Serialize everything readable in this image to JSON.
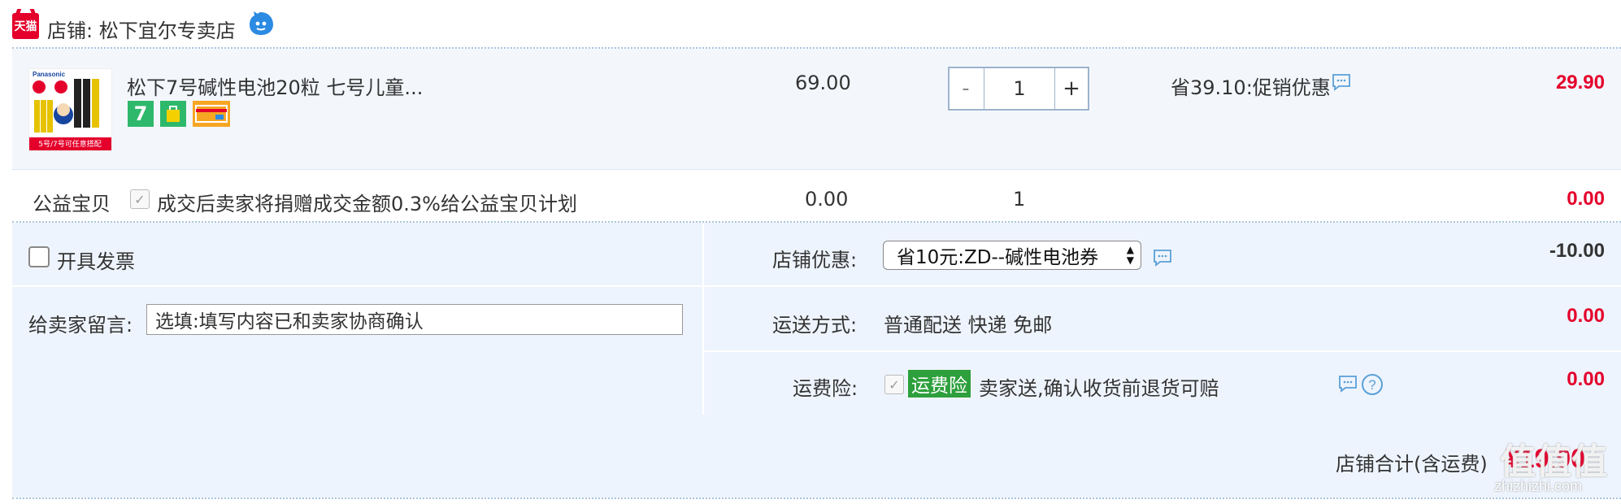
{
  "shop": {
    "label": "店铺: 松下宜尔专卖店",
    "logo_text": "天猫"
  },
  "item": {
    "title": "松下7号碱性电池20粒 七号儿童...",
    "unit_price": "69.00",
    "quantity": "1",
    "qty_minus": "-",
    "qty_plus": "+",
    "promo": "省39.10:促销优惠",
    "subtotal": "29.90",
    "image_brand": "Panasonic",
    "image_caption": "5号/7号可任意搭配"
  },
  "charity": {
    "label": "公益宝贝",
    "description": "成交后卖家将捐赠成交金额0.3%给公益宝贝计划",
    "price": "0.00",
    "quantity": "1",
    "subtotal": "0.00"
  },
  "invoice": {
    "label": "开具发票"
  },
  "shop_discount": {
    "label": "店铺优惠:",
    "selected": "省10元:ZD--碱性电池券",
    "amount": "-10.00"
  },
  "message": {
    "label": "给卖家留言:",
    "placeholder": "选填:填写内容已和卖家协商确认"
  },
  "shipping": {
    "label": "运送方式:",
    "value": "普通配送 快递 免邮",
    "amount": "0.00"
  },
  "insurance": {
    "label": "运费险:",
    "badge": "运费险",
    "description": "卖家送,确认收货前退货可赔",
    "amount": "0.00"
  },
  "total": {
    "label": "店铺合计(含运费)",
    "amount": "¥19.90"
  },
  "watermark": {
    "big": "值值值",
    "small": "zhizhizhi.com"
  },
  "colors": {
    "accent_red": "#e4002b",
    "row_bg": "#eef4fd",
    "border_blue": "#a9c4dc",
    "badge_green": "#2d9f3c"
  }
}
